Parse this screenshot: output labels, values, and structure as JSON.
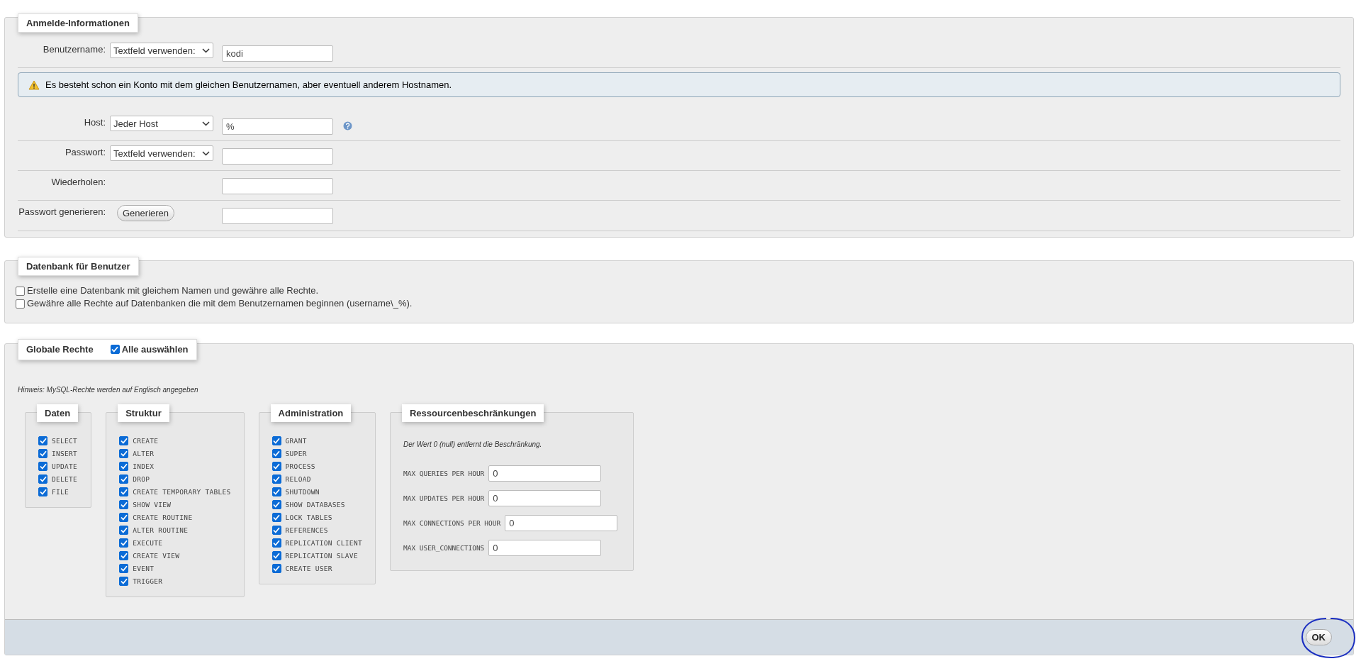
{
  "login": {
    "title": "Anmelde-Informationen",
    "rows": [
      {
        "kind": "select_input",
        "label": "Benutzername:",
        "select": "Textfeld verwenden:",
        "value": "kodi",
        "help": false
      },
      {
        "kind": "notice",
        "text": "Es besteht schon ein Konto mit dem gleichen Benutzernamen, aber eventuell anderem Hostnamen."
      },
      {
        "kind": "select_input",
        "label": "Host:",
        "select": "Jeder Host",
        "value": "%",
        "help": true
      },
      {
        "kind": "select_input",
        "label": "Passwort:",
        "select": "Textfeld verwenden:",
        "help": false
      },
      {
        "kind": "input",
        "label": "Wiederholen:"
      },
      {
        "kind": "button_input",
        "label": "Passwort generieren:",
        "button": "Generieren"
      }
    ]
  },
  "database": {
    "title": "Datenbank für Benutzer",
    "options": [
      {
        "label": "Erstelle eine Datenbank mit gleichem Namen und gewähre alle Rechte.",
        "checked": false
      },
      {
        "label": "Gewähre alle Rechte auf Datenbanken die mit dem Benutzernamen beginnen (username\\_%).",
        "checked": false
      }
    ]
  },
  "global": {
    "title": "Globale Rechte",
    "select_all": {
      "label": "Alle auswählen",
      "checked": true
    },
    "hint": "Hinweis: MySQL-Rechte werden auf Englisch angegeben",
    "groups": [
      {
        "title": "Daten",
        "privileges": [
          {
            "label": "SELECT",
            "checked": true
          },
          {
            "label": "INSERT",
            "checked": true
          },
          {
            "label": "UPDATE",
            "checked": true
          },
          {
            "label": "DELETE",
            "checked": true
          },
          {
            "label": "FILE",
            "checked": true
          }
        ]
      },
      {
        "title": "Struktur",
        "privileges": [
          {
            "label": "CREATE",
            "checked": true
          },
          {
            "label": "ALTER",
            "checked": true
          },
          {
            "label": "INDEX",
            "checked": true
          },
          {
            "label": "DROP",
            "checked": true
          },
          {
            "label": "CREATE TEMPORARY TABLES",
            "checked": true
          },
          {
            "label": "SHOW VIEW",
            "checked": true
          },
          {
            "label": "CREATE ROUTINE",
            "checked": true
          },
          {
            "label": "ALTER ROUTINE",
            "checked": true
          },
          {
            "label": "EXECUTE",
            "checked": true
          },
          {
            "label": "CREATE VIEW",
            "checked": true
          },
          {
            "label": "EVENT",
            "checked": true
          },
          {
            "label": "TRIGGER",
            "checked": true
          }
        ]
      },
      {
        "title": "Administration",
        "privileges": [
          {
            "label": "GRANT",
            "checked": true
          },
          {
            "label": "SUPER",
            "checked": true
          },
          {
            "label": "PROCESS",
            "checked": true
          },
          {
            "label": "RELOAD",
            "checked": true
          },
          {
            "label": "SHUTDOWN",
            "checked": true
          },
          {
            "label": "SHOW DATABASES",
            "checked": true
          },
          {
            "label": "LOCK TABLES",
            "checked": true
          },
          {
            "label": "REFERENCES",
            "checked": true
          },
          {
            "label": "REPLICATION CLIENT",
            "checked": true
          },
          {
            "label": "REPLICATION SLAVE",
            "checked": true
          },
          {
            "label": "CREATE USER",
            "checked": true
          }
        ]
      }
    ],
    "limits": {
      "title": "Ressourcenbeschränkungen",
      "note": "Der Wert 0 (null) entfernt die Beschränkung.",
      "fields": [
        {
          "label": "MAX QUERIES PER HOUR",
          "value": "0"
        },
        {
          "label": "MAX UPDATES PER HOUR",
          "value": "0"
        },
        {
          "label": "MAX CONNECTIONS PER HOUR",
          "value": "0"
        },
        {
          "label": "MAX USER_CONNECTIONS",
          "value": "0"
        }
      ]
    }
  },
  "footer": {
    "button": "OK"
  }
}
